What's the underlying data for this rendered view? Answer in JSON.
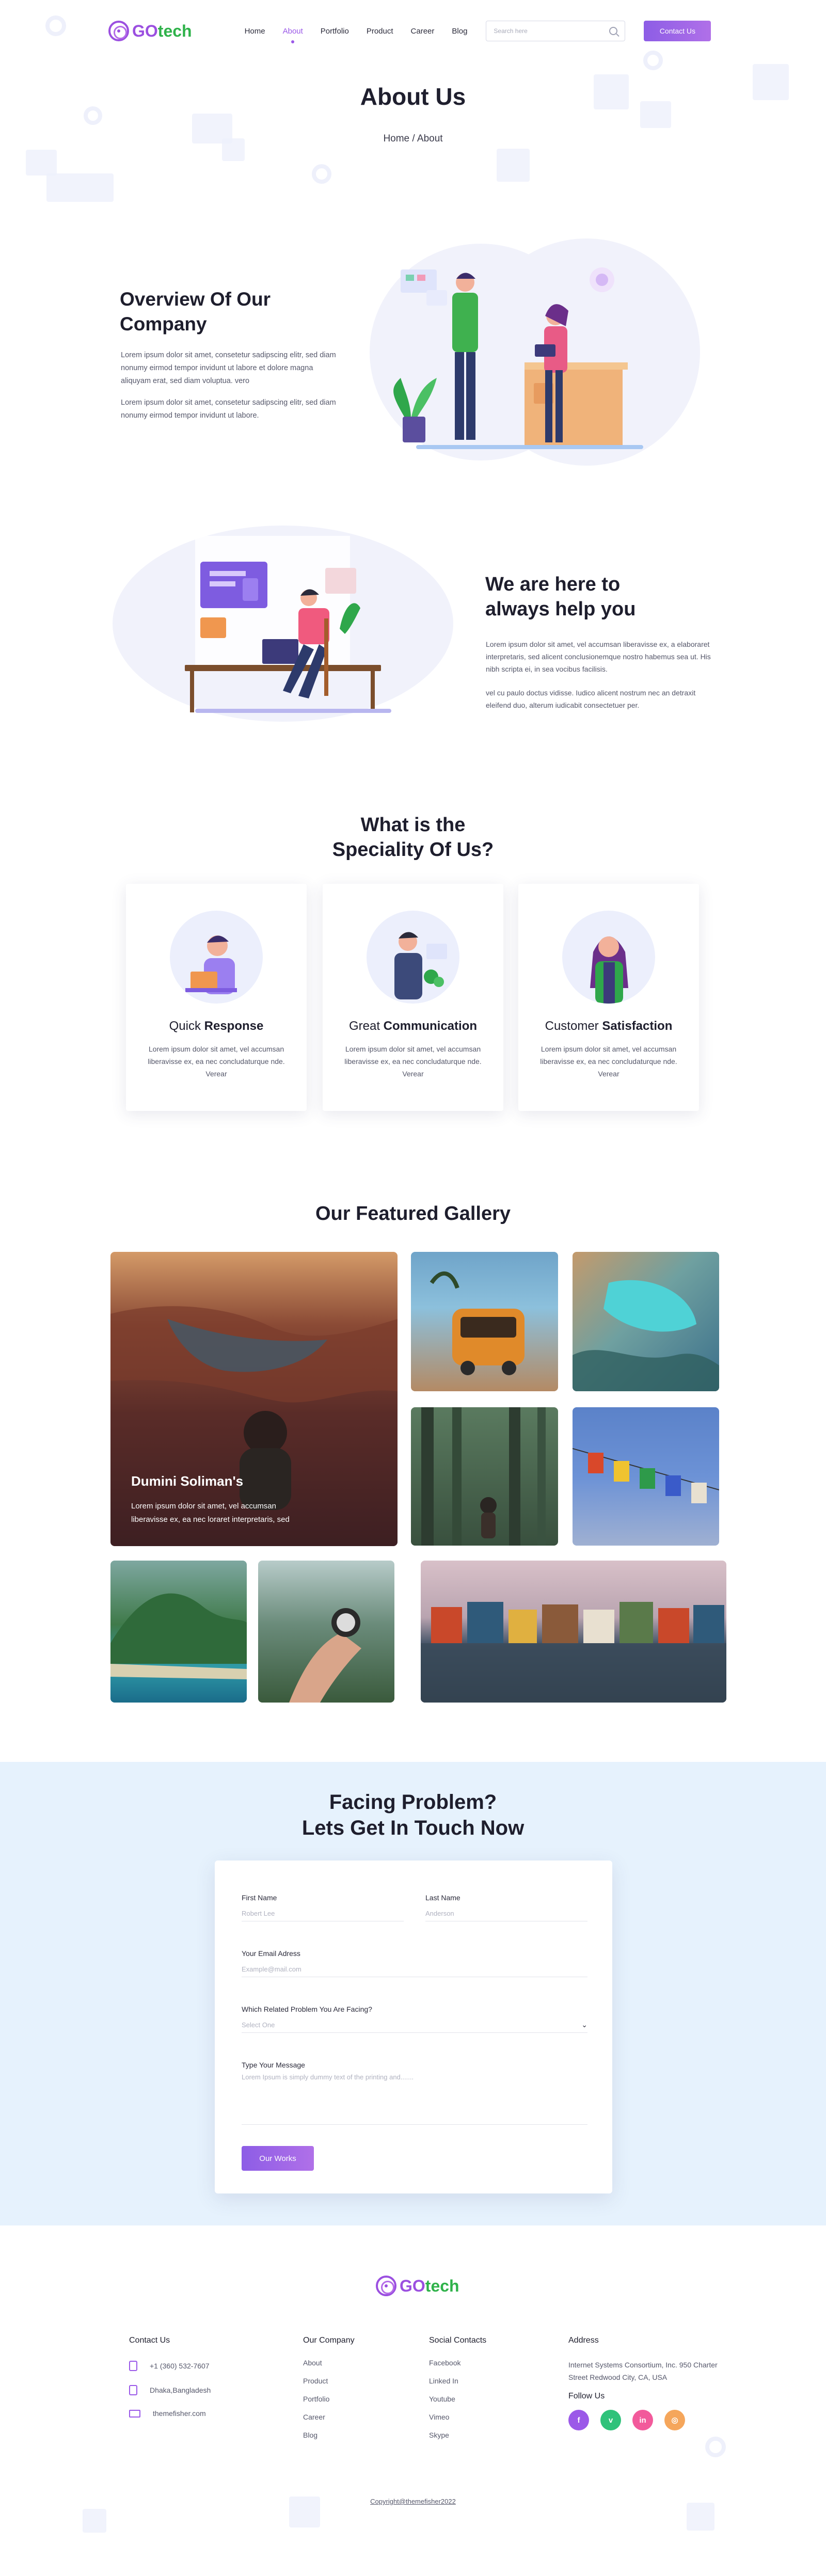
{
  "header": {
    "logo": {
      "go": "GO",
      "tech": "tech"
    },
    "nav": [
      {
        "label": "Home",
        "active": false
      },
      {
        "label": "About",
        "active": true
      },
      {
        "label": "Portfolio",
        "active": false
      },
      {
        "label": "Product",
        "active": false
      },
      {
        "label": "Career",
        "active": false
      },
      {
        "label": "Blog",
        "active": false
      }
    ],
    "search": {
      "placeholder": "Search here",
      "icon": "search-icon"
    },
    "contact_button": "Contact Us"
  },
  "hero": {
    "title_bold": "About",
    "title_rest": " Us",
    "breadcrumb": "Home / About"
  },
  "overview": {
    "title_bold": "Overview Of",
    "title_rest": " Our Company",
    "paragraphs": [
      "Lorem ipsum dolor sit amet, consetetur sadipscing elitr, sed diam nonumy eirmod tempor invidunt ut labore et dolore magna aliquyam erat, sed diam voluptua. vero",
      "Lorem ipsum dolor sit amet, consetetur sadipscing elitr, sed diam nonumy eirmod tempor invidunt ut labore."
    ]
  },
  "help": {
    "title_line1": "We are here to",
    "title_bold": "always help",
    "title_rest": " you",
    "paragraphs": [
      "Lorem ipsum dolor sit amet, vel accumsan liberavisse ex, a elaboraret interpretaris, sed alicent conclusionemque nostro habemus sea ut. His nibh scripta ei, in sea vocibus facilisis.",
      "vel cu paulo doctus vidisse. Iudico alicent nostrum nec an detraxit eleifend duo, alterum iudicabit consectetuer per."
    ]
  },
  "speciality": {
    "title_line1": "What is the",
    "title_line2": "Speciality Of Us?",
    "cards": [
      {
        "title_light": "Quick ",
        "title_bold": "Response",
        "text": "Lorem ipsum dolor sit amet, vel accumsan liberavisse ex, ea nec concludaturque nde. Verear",
        "avatar": "person-laptop-icon"
      },
      {
        "title_light": "Great ",
        "title_bold": "Communication",
        "text": "Lorem ipsum dolor sit amet, vel accumsan liberavisse ex, ea nec concludaturque nde. Verear",
        "avatar": "person-presenting-icon"
      },
      {
        "title_light": "Customer ",
        "title_bold": "Satisfaction",
        "text": "Lorem ipsum dolor sit amet, vel accumsan liberavisse ex, ea nec concludaturque nde. Verear",
        "avatar": "woman-smiling-icon"
      }
    ]
  },
  "gallery": {
    "title_light": "Our Featured ",
    "title_bold": "Gallery",
    "featured": {
      "name": "Dumini Soliman's",
      "description": "Lorem ipsum dolor sit amet, vel accumsan liberavisse ex, ea nec loraret interpretaris, sed"
    }
  },
  "contact": {
    "title_line1": "Facing Problem?",
    "title_line2": "Lets Get In Touch Now",
    "form": {
      "first_name_label": "First Name",
      "first_name_placeholder": "Robert Lee",
      "last_name_label": "Last Name",
      "last_name_placeholder": "Anderson",
      "email_label": "Your Email Adress",
      "email_placeholder": "Example@mail.com",
      "problem_label": "Which Related Problem You Are Facing?",
      "problem_selected": "Select One",
      "message_label": "Type Your Message",
      "message_placeholder": "Lorem Ipsum is simply dummy text of the printing and.......",
      "submit": "Our Works"
    }
  },
  "footer": {
    "logo": {
      "go": "GO",
      "tech": "tech"
    },
    "contact_us": {
      "title": "Contact Us",
      "phone": "+1 (360) 532-7607",
      "email": "Dhaka,Bangladesh",
      "website": "themefisher.com"
    },
    "company": {
      "title": "Our Company",
      "links": [
        "About",
        "Product",
        "Portfolio",
        "Career",
        "Blog"
      ]
    },
    "social": {
      "title": "Social Contacts",
      "links": [
        "Facebook",
        "Linked In",
        "Youtube",
        "Vimeo",
        "Skype"
      ]
    },
    "address": {
      "title": "Address",
      "text": "Internet Systems Consortium, Inc. 950 Charter Street Redwood City, CA, USA",
      "follow_title": "Follow Us",
      "icons": [
        {
          "name": "facebook-icon",
          "glyph": "f",
          "color": "#9b59e8"
        },
        {
          "name": "vine-icon",
          "glyph": "v",
          "color": "#2fc27a"
        },
        {
          "name": "linkedin-icon",
          "glyph": "in",
          "color": "#f25a9b"
        },
        {
          "name": "rss-icon",
          "glyph": "◎",
          "color": "#f5a65b"
        }
      ]
    },
    "copyright": "Copyright@themefisher2022"
  }
}
